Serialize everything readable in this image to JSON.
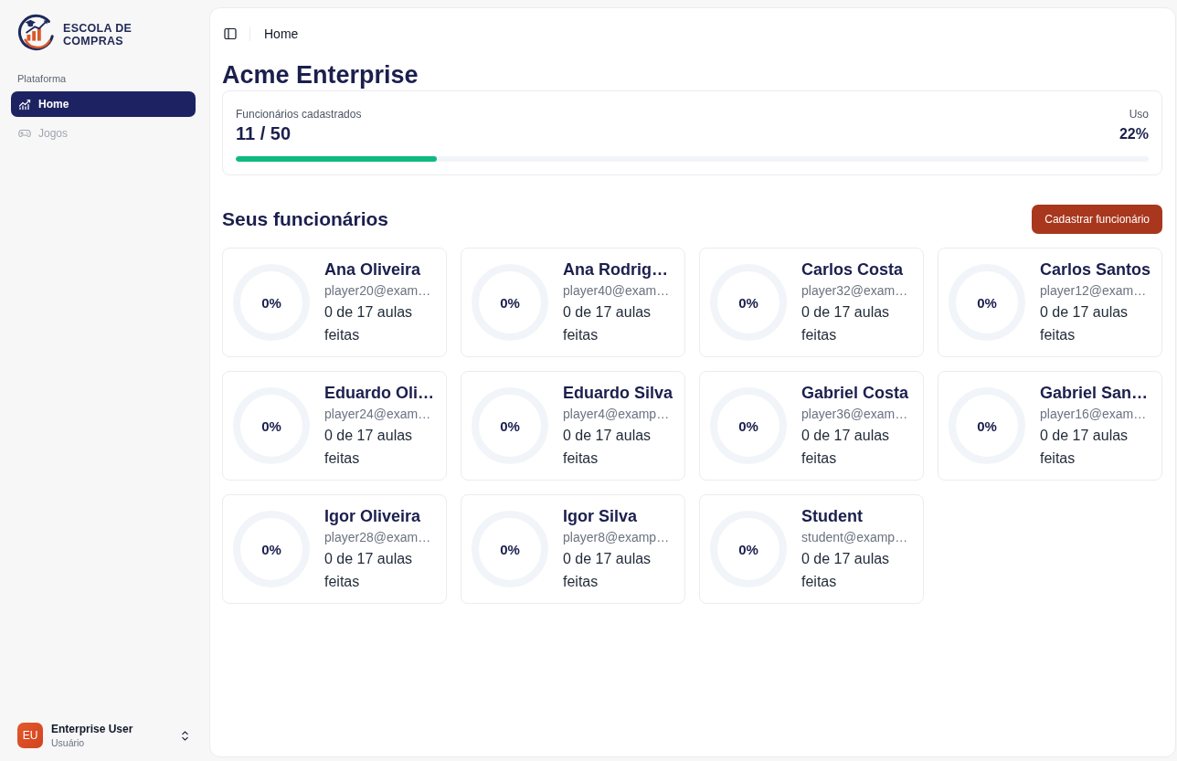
{
  "sidebar": {
    "logo": {
      "lines": [
        "ESCOLA DE",
        "COMPRAS"
      ]
    },
    "group_label": "Plataforma",
    "items": [
      {
        "label": "Home",
        "kind": "dashboard",
        "selected": true,
        "disabled": false
      },
      {
        "label": "Jogos",
        "kind": "games",
        "selected": false,
        "disabled": true
      }
    ],
    "user": {
      "initials": "EU",
      "name": "Enterprise User",
      "role": "Usuário"
    }
  },
  "header": {
    "breadcrumb": "Home"
  },
  "page_title": "Acme Enterprise",
  "usage_card": {
    "label": "Funcionários cadastrados",
    "count": "11 / 50",
    "usage_label": "Uso",
    "usage_value": "22%",
    "level": 0.22
  },
  "employees_section": {
    "title": "Seus funcionários",
    "add_button": "Cadastrar funcionário",
    "employees": [
      {
        "name": "Ana Oliveira",
        "email": "player20@exam…",
        "lessons": "0 de 17 aulas feitas",
        "progress": "0%"
      },
      {
        "name": "Ana Rodrig…",
        "email": "player40@exam…",
        "lessons": "0 de 17 aulas feitas",
        "progress": "0%"
      },
      {
        "name": "Carlos Costa",
        "email": "player32@exam…",
        "lessons": "0 de 17 aulas feitas",
        "progress": "0%"
      },
      {
        "name": "Carlos Santos",
        "email": "player12@exam…",
        "lessons": "0 de 17 aulas feitas",
        "progress": "0%"
      },
      {
        "name": "Eduardo Oli…",
        "email": "player24@exam…",
        "lessons": "0 de 17 aulas feitas",
        "progress": "0%"
      },
      {
        "name": "Eduardo Silva",
        "email": "player4@examp…",
        "lessons": "0 de 17 aulas feitas",
        "progress": "0%"
      },
      {
        "name": "Gabriel Costa",
        "email": "player36@exam…",
        "lessons": "0 de 17 aulas feitas",
        "progress": "0%"
      },
      {
        "name": "Gabriel San…",
        "email": "player16@exam…",
        "lessons": "0 de 17 aulas feitas",
        "progress": "0%"
      },
      {
        "name": "Igor Oliveira",
        "email": "player28@exam…",
        "lessons": "0 de 17 aulas feitas",
        "progress": "0%"
      },
      {
        "name": "Igor Silva",
        "email": "player8@examp…",
        "lessons": "0 de 17 aulas feitas",
        "progress": "0%"
      },
      {
        "name": "Student",
        "email": "student@examp…",
        "lessons": "0 de 17 aulas feitas",
        "progress": "0%"
      }
    ]
  }
}
